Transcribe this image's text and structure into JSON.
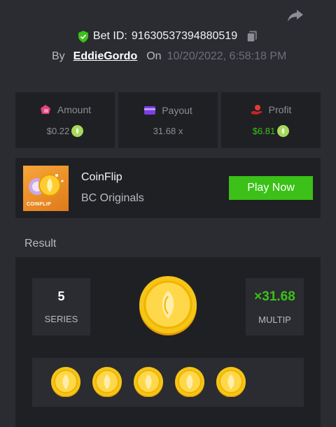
{
  "header": {
    "bet_id_label": "Bet ID:",
    "bet_id": "91630537394880519",
    "by_label": "By",
    "username": "EddieGordo",
    "on_label": "On",
    "datetime": "10/20/2022, 6:58:18 PM"
  },
  "stats": [
    {
      "label": "Amount",
      "value": "$0.22",
      "icon": "amount-icon"
    },
    {
      "label": "Payout",
      "value": "31.68 x",
      "icon": "payout-card-icon"
    },
    {
      "label": "Profit",
      "value": "$6.81",
      "icon": "profit-icon"
    }
  ],
  "game": {
    "thumb_label": "COINFLIP",
    "name": "CoinFlip",
    "provider": "BC Originals",
    "play_label": "Play Now"
  },
  "result": {
    "title": "Result",
    "series": "5",
    "series_label": "SERIES",
    "multiplier": "×31.68",
    "multiplier_label": "MULTIP",
    "coin_count": 5
  },
  "colors": {
    "background": "#2a2c31",
    "panel": "#1f2024",
    "accent_green": "#3bc117",
    "coin_gold": "#f5c518"
  }
}
